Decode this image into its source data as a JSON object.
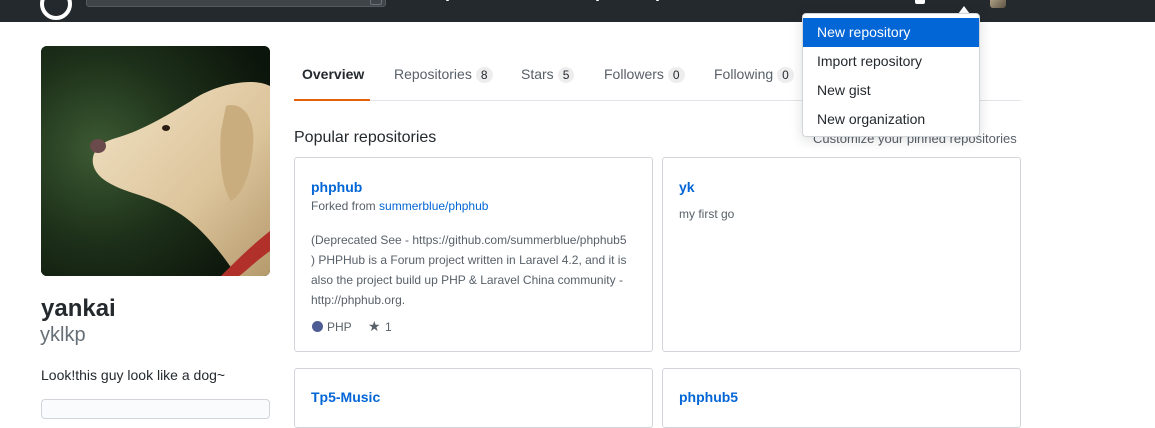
{
  "profile": {
    "fullname": "yankai",
    "username": "yklkp",
    "bio": "Look!this guy look like a dog~"
  },
  "tabs": [
    {
      "label": "Overview",
      "count": null
    },
    {
      "label": "Repositories",
      "count": "8"
    },
    {
      "label": "Stars",
      "count": "5"
    },
    {
      "label": "Followers",
      "count": "0"
    },
    {
      "label": "Following",
      "count": "0"
    }
  ],
  "popular": {
    "title": "Popular repositories",
    "customize": "Customize your pinned repositories"
  },
  "repos": [
    {
      "name": "phphub",
      "forked_prefix": "Forked from",
      "forked_from": "summerblue/phphub",
      "description_lines": [
        "(Deprecated See - https://github.com/summerblue/phphub5",
        ") PHPHub is a Forum project written in Laravel 4.2, and it is",
        "also the project build up PHP & Laravel China community -",
        "http://phphub.org."
      ],
      "language": "PHP",
      "language_color": "#4F5D95",
      "stars": "1"
    },
    {
      "name": "yk",
      "description": "my first go"
    },
    {
      "name": "Tp5-Music"
    },
    {
      "name": "phphub5"
    }
  ],
  "dropdown": {
    "items": [
      {
        "label": "New repository"
      },
      {
        "label": "Import repository"
      },
      {
        "label": "New gist"
      },
      {
        "label": "New organization"
      }
    ]
  },
  "icons": {
    "star": "★"
  },
  "colors": {
    "header_bg": "#24292e",
    "link": "#0366d6",
    "tab_underline": "#e36209",
    "dropdown_active": "#0366d6"
  }
}
